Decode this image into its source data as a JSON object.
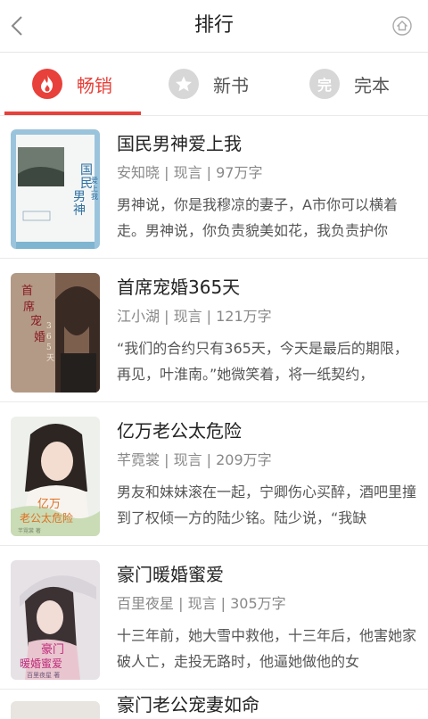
{
  "header": {
    "title": "排行",
    "back_icon": "chevron-left-icon",
    "home_icon": "home-icon"
  },
  "tabs": [
    {
      "label": "畅销",
      "icon": "flame-icon",
      "active": true,
      "color": "#e8403a"
    },
    {
      "label": "新书",
      "icon": "star-icon",
      "active": false
    },
    {
      "label": "完本",
      "icon": "complete-badge-icon",
      "badge_text": "完",
      "active": false
    }
  ],
  "books": [
    {
      "title": "国民男神爱上我",
      "author": "安知晓",
      "genre": "现言",
      "words": "97万字",
      "meta": "安知晓 | 现言 | 97万字",
      "desc": "男神说，你是我穆凉的妻子，A市你可以横着走。男神说，你负责貌美如花，我负责护你",
      "cover_title": "国民男神",
      "cover_sub": "爱上我"
    },
    {
      "title": "首席宠婚365天",
      "author": "江小湖",
      "genre": "现言",
      "words": "121万字",
      "meta": "江小湖 | 现言 | 121万字",
      "desc": "“我们的合约只有365天，今天是最后的期限，再见，叶淮南。”她微笑着，将一纸契约，",
      "cover_title": "首席宠婚",
      "cover_sub": "365天"
    },
    {
      "title": "亿万老公太危险",
      "author": "芊霓裳",
      "genre": "现言",
      "words": "209万字",
      "meta": "芊霓裳 | 现言 | 209万字",
      "desc": "男友和妹妹滚在一起，宁卿伤心买醉，酒吧里撞到了权倾一方的陆少铭。陆少说，“我缺",
      "cover_title": "亿万老公太危险",
      "cover_sub": "芊霓裳 著"
    },
    {
      "title": "豪门暖婚蜜爱",
      "author": "百里夜星",
      "genre": "现言",
      "words": "305万字",
      "meta": "百里夜星 | 现言 | 305万字",
      "desc": "十三年前，她大雪中救他，十三年后，他害她家破人亡，走投无路时，他逼她做他的女",
      "cover_title": "豪门暖婚蜜爱",
      "cover_sub": "百里夜星 著"
    }
  ],
  "partial_item": {
    "title": "豪门老公宠妻如命"
  }
}
